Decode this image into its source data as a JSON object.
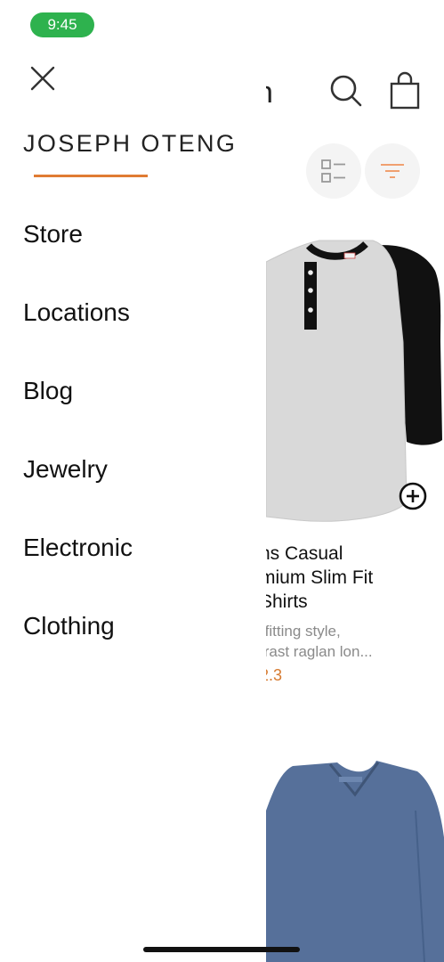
{
  "status_bar": {
    "time": "9:45"
  },
  "drawer": {
    "user_name": "JOSEPH OTENG",
    "menu": [
      {
        "label": "Store"
      },
      {
        "label": "Locations"
      },
      {
        "label": "Blog"
      },
      {
        "label": "Jewelry"
      },
      {
        "label": "Electronic"
      },
      {
        "label": "Clothing"
      }
    ]
  },
  "store_page": {
    "title_fragment": "n",
    "products": [
      {
        "name_lines": [
          "ns Casual",
          "mium Slim Fit",
          "Shirts"
        ],
        "description_lines": [
          "-fitting style,",
          "trast raglan lon..."
        ],
        "price": "2.3"
      }
    ]
  },
  "colors": {
    "accent": "#e07c33",
    "price": "#d67a2f",
    "status_pill": "#2eb24e",
    "text": "#111111",
    "muted": "#8a8a8a"
  },
  "icons": [
    "close-icon",
    "search-icon",
    "shopping-bag-icon",
    "list-layout-icon",
    "filter-icon",
    "add-circle-icon"
  ]
}
